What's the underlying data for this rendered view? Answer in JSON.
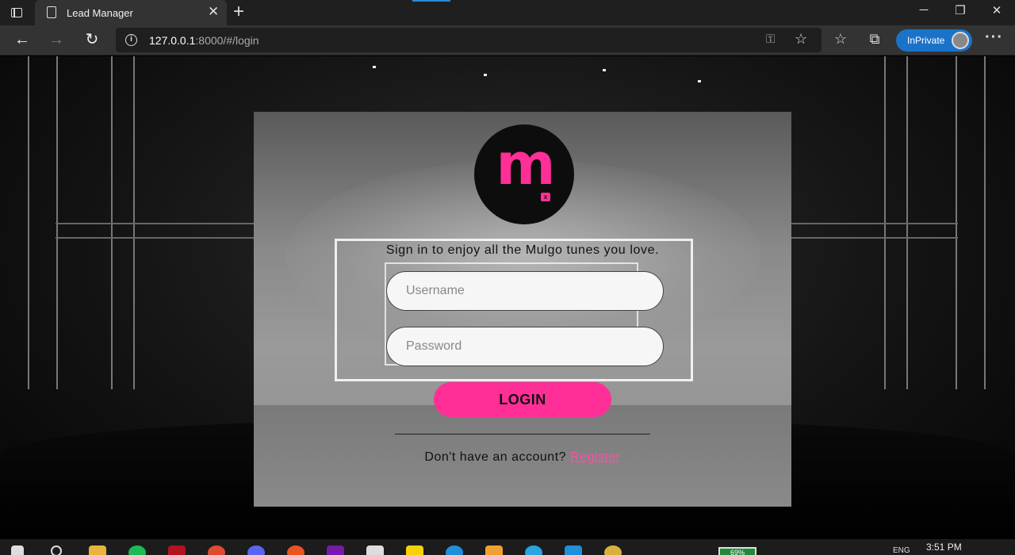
{
  "browser": {
    "tab_title": "Lead Manager",
    "tab_close": "✕",
    "new_tab": "+",
    "url_host": "127.0.0.1",
    "url_rest": ":8000/#/login",
    "inprivate_label": "InPrivate",
    "minimize": "─",
    "restore": "❐",
    "close": "✕",
    "more": "···"
  },
  "login": {
    "logo_letter": "m",
    "logo_badge": "x",
    "tagline": "Sign in to enjoy all the Mulgo tunes you love.",
    "username_placeholder": "Username",
    "password_placeholder": "Password",
    "username_value": "",
    "password_value": "",
    "login_button": "LOGIN",
    "signup_prompt": "Don't have an account?",
    "signup_link": "Register"
  },
  "taskbar": {
    "battery": "69%",
    "lang": "ENG",
    "time": "3:51 PM"
  },
  "colors": {
    "accent_pink": "#ff2f97",
    "inprivate_blue": "#1a73c9",
    "chrome_dark": "#1f1f1f"
  },
  "icons": [
    "tab-actions-icon",
    "page-icon",
    "back-arrow-icon",
    "forward-arrow-icon",
    "refresh-icon",
    "site-info-icon",
    "key-icon",
    "add-favorite-icon",
    "favorites-icon",
    "collections-icon",
    "profile-avatar-icon",
    "more-icon"
  ]
}
